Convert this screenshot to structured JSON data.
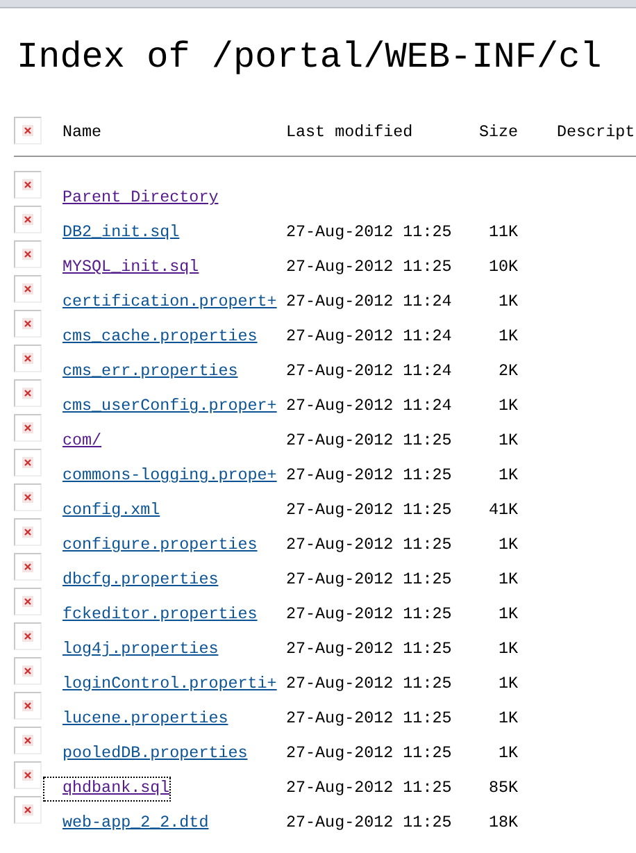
{
  "title": "Index of /portal/WEB-INF/cl",
  "columns": [
    "Name",
    "Last modified",
    "Size",
    "Descript"
  ],
  "rows": [
    {
      "name": "Parent Directory",
      "visited": true,
      "focused": false
    },
    {
      "name": "DB2_init.sql",
      "modified": "27-Aug-2012 11:25",
      "size": "11K",
      "visited": false,
      "focused": false
    },
    {
      "name": "MYSQL_init.sql",
      "modified": "27-Aug-2012 11:25",
      "size": "10K",
      "visited": true,
      "focused": false
    },
    {
      "name": "certification.propert+",
      "modified": "27-Aug-2012 11:24",
      "size": "1K",
      "visited": false,
      "focused": false
    },
    {
      "name": "cms_cache.properties",
      "modified": "27-Aug-2012 11:24",
      "size": "1K",
      "visited": false,
      "focused": false
    },
    {
      "name": "cms_err.properties",
      "modified": "27-Aug-2012 11:24",
      "size": "2K",
      "visited": false,
      "focused": false
    },
    {
      "name": "cms_userConfig.proper+",
      "modified": "27-Aug-2012 11:24",
      "size": "1K",
      "visited": false,
      "focused": false
    },
    {
      "name": "com/",
      "modified": "27-Aug-2012 11:25",
      "size": "1K",
      "visited": true,
      "focused": false
    },
    {
      "name": "commons-logging.prope+",
      "modified": "27-Aug-2012 11:25",
      "size": "1K",
      "visited": false,
      "focused": false
    },
    {
      "name": "config.xml",
      "modified": "27-Aug-2012 11:25",
      "size": "41K",
      "visited": false,
      "focused": false
    },
    {
      "name": "configure.properties",
      "modified": "27-Aug-2012 11:25",
      "size": "1K",
      "visited": false,
      "focused": false
    },
    {
      "name": "dbcfg.properties",
      "modified": "27-Aug-2012 11:25",
      "size": "1K",
      "visited": false,
      "focused": false
    },
    {
      "name": "fckeditor.properties",
      "modified": "27-Aug-2012 11:25",
      "size": "1K",
      "visited": false,
      "focused": false
    },
    {
      "name": "log4j.properties",
      "modified": "27-Aug-2012 11:25",
      "size": "1K",
      "visited": false,
      "focused": false
    },
    {
      "name": "loginControl.properti+",
      "modified": "27-Aug-2012 11:25",
      "size": "1K",
      "visited": false,
      "focused": false
    },
    {
      "name": "lucene.properties",
      "modified": "27-Aug-2012 11:25",
      "size": "1K",
      "visited": false,
      "focused": false
    },
    {
      "name": "pooledDB.properties",
      "modified": "27-Aug-2012 11:25",
      "size": "1K",
      "visited": false,
      "focused": false
    },
    {
      "name": "qhdbank.sql",
      "modified": "27-Aug-2012 11:25",
      "size": "85K",
      "visited": true,
      "focused": true
    },
    {
      "name": "web-app_2_2.dtd",
      "modified": "27-Aug-2012 11:25",
      "size": "18K",
      "visited": false,
      "focused": false
    }
  ]
}
